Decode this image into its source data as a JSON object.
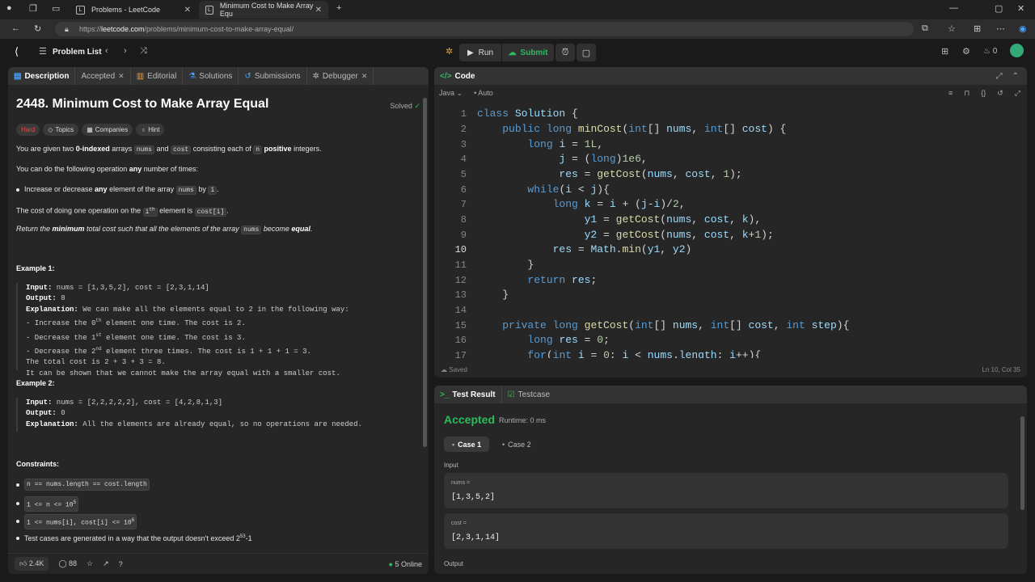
{
  "browser": {
    "tabs": [
      {
        "title": "Problems - LeetCode"
      },
      {
        "title": "Minimum Cost to Make Array Equ"
      }
    ],
    "url_host": "leetcode.com",
    "url_path": "/problems/minimum-cost-to-make-array-equal/",
    "url_scheme": "https://"
  },
  "nav": {
    "problem_list": "Problem List",
    "run": "Run",
    "submit": "Submit",
    "streak": "0"
  },
  "desc_tabs": [
    "Description",
    "Accepted",
    "Editorial",
    "Solutions",
    "Submissions",
    "Debugger"
  ],
  "problem": {
    "title": "2448. Minimum Cost to Make Array Equal",
    "status": "Solved",
    "difficulty": "Hard",
    "tags": [
      "Topics",
      "Companies",
      "Hint"
    ],
    "p1_a": "You are given two ",
    "p1_b": "0-indexed",
    "p1_c": " arrays ",
    "p1_d": "nums",
    "p1_e": " and ",
    "p1_f": "cost",
    "p1_g": " consisting each of ",
    "p1_h": "n",
    "p1_i": " positive",
    "p1_j": " integers.",
    "p2_a": "You can do the following operation ",
    "p2_b": "any",
    "p2_c": " number of times:",
    "b1_a": "Increase or decrease ",
    "b1_b": "any",
    "b1_c": " element of the array ",
    "b1_d": "nums",
    "b1_e": " by ",
    "b1_f": "1",
    "b1_g": ".",
    "p3_a": "The cost of doing one operation on the ",
    "p3_b": "i",
    "p3_sup": "th",
    "p3_c": " element is ",
    "p3_d": "cost[i]",
    "p3_e": ".",
    "p4_a": "Return the ",
    "p4_b": "minimum",
    "p4_c": " total cost such that all the elements of the array ",
    "p4_d": "nums",
    "p4_e": " become ",
    "p4_f": "equal",
    "p4_g": ".",
    "ex1_title": "Example 1:",
    "ex1_input_k": "Input:",
    "ex1_input_v": " nums = [1,3,5,2], cost = [2,3,1,14]",
    "ex1_output_k": "Output:",
    "ex1_output_v": " 8",
    "ex1_expl_k": "Explanation:",
    "ex1_expl_v": " We can make all the elements equal to 2 in the following way:",
    "ex1_l1a": "- Increase the 0",
    "ex1_l1s": "th",
    "ex1_l1b": " element one time. The cost is 2.",
    "ex1_l2a": "- Decrease the 1",
    "ex1_l2s": "st",
    "ex1_l2b": " element one time. The cost is 3.",
    "ex1_l3a": "- Decrease the 2",
    "ex1_l3s": "nd",
    "ex1_l3b": " element three times. The cost is 1 + 1 + 1 = 3.",
    "ex1_l4": "The total cost is 2 + 3 + 3 = 8.",
    "ex1_l5": "It can be shown that we cannot make the array equal with a smaller cost.",
    "ex2_title": "Example 2:",
    "ex2_input_k": "Input:",
    "ex2_input_v": " nums = [2,2,2,2,2], cost = [4,2,8,1,3]",
    "ex2_output_k": "Output:",
    "ex2_output_v": " 0",
    "ex2_expl_k": "Explanation:",
    "ex2_expl_v": " All the elements are already equal, so no operations are needed.",
    "constraints_title": "Constraints:",
    "c1": "n == nums.length == cost.length",
    "c2a": "1 <= n <= 10",
    "c2s": "5",
    "c3a": "1 <= nums[i], cost[i] <= 10",
    "c3s": "6",
    "c4a": "Test cases are generated in a way that the output doesn't exceed 2",
    "c4s": "53",
    "c4b": "-1"
  },
  "desc_footer": {
    "likes": "2.4K",
    "comments": "88",
    "online": "5 Online"
  },
  "code_panel": {
    "title": "Code",
    "language": "Java",
    "mode": "Auto",
    "saved": "Saved",
    "cursor": "Ln 10, Col 35"
  },
  "code_lines": [
    {
      "n": "1"
    },
    {
      "n": "2"
    },
    {
      "n": "3"
    },
    {
      "n": "4"
    },
    {
      "n": "5"
    },
    {
      "n": "6"
    },
    {
      "n": "7"
    },
    {
      "n": "8"
    },
    {
      "n": "9"
    },
    {
      "n": "10"
    },
    {
      "n": "11"
    },
    {
      "n": "12"
    },
    {
      "n": "13"
    },
    {
      "n": "14"
    },
    {
      "n": "15"
    },
    {
      "n": "16"
    },
    {
      "n": "17"
    }
  ],
  "result": {
    "tab1": "Test Result",
    "tab2": "Testcase",
    "status": "Accepted",
    "runtime": "Runtime: 0 ms",
    "case1": "Case 1",
    "case2": "Case 2",
    "input_label": "Input",
    "nums_label": "nums =",
    "nums_value": "[1,3,5,2]",
    "cost_label": "cost =",
    "cost_value": "[2,3,1,14]",
    "output_label": "Output"
  }
}
